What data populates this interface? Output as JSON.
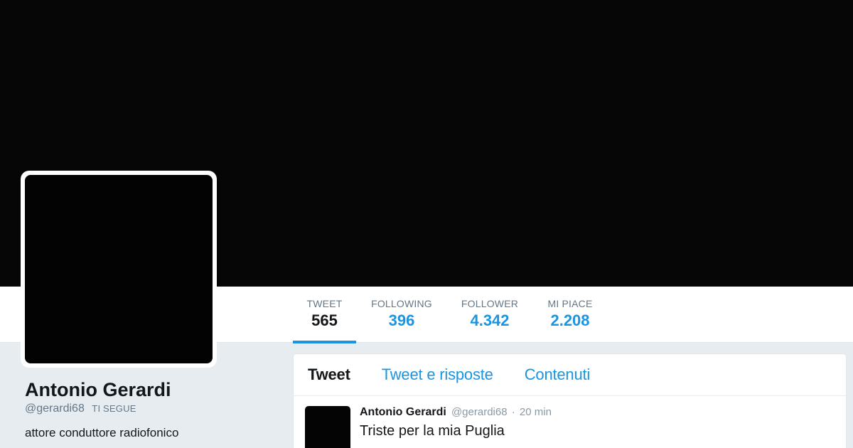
{
  "profile": {
    "name": "Antonio Gerardi",
    "handle": "@gerardi68",
    "follows_you": "TI SEGUE",
    "bio": "attore conduttore radiofonico"
  },
  "stats": [
    {
      "label": "TWEET",
      "value": "565",
      "active": true
    },
    {
      "label": "FOLLOWING",
      "value": "396",
      "active": false
    },
    {
      "label": "FOLLOWER",
      "value": "4.342",
      "active": false
    },
    {
      "label": "MI PIACE",
      "value": "2.208",
      "active": false
    }
  ],
  "timeline": {
    "tabs": [
      {
        "label": "Tweet",
        "active": true
      },
      {
        "label": "Tweet e risposte",
        "active": false
      },
      {
        "label": "Contenuti",
        "active": false
      }
    ],
    "tweet": {
      "author": "Antonio Gerardi",
      "handle": "@gerardi68",
      "separator": "·",
      "time": "20 min",
      "text": "Triste per la mia Puglia"
    }
  },
  "colors": {
    "accent": "#1b95e0",
    "banner": "#060606",
    "background": "#e6ecf0"
  }
}
